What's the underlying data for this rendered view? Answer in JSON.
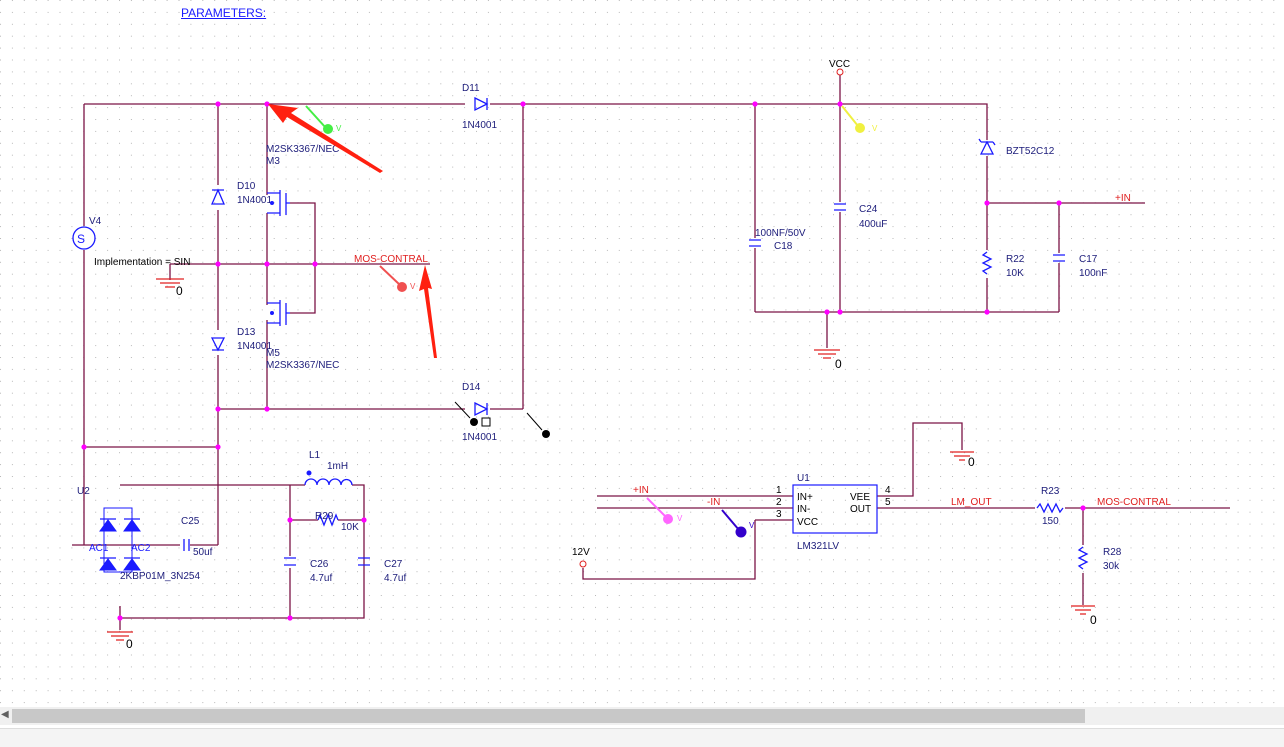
{
  "parameters_label": "PARAMETERS:",
  "colors": {
    "wire": "#7b1446",
    "junction": "#ff00ff",
    "symbol": "#1a1aff",
    "net_label": "#e02020",
    "annotation_arrow": "#ff2010"
  },
  "components": {
    "v4": {
      "ref": "V4",
      "value": "Implementation = SIN",
      "glyph": "S"
    },
    "d10": {
      "ref": "D10",
      "value": "1N4001"
    },
    "d13": {
      "ref": "D13",
      "value": "1N4001"
    },
    "d11": {
      "ref": "D11",
      "value": "1N4001"
    },
    "d14": {
      "ref": "D14",
      "value": "1N4001"
    },
    "m3": {
      "ref": "M3",
      "value": "M2SK3367/NEC"
    },
    "m5": {
      "ref": "M5",
      "value": "M2SK3367/NEC"
    },
    "u2": {
      "ref": "U2",
      "value": "2KBP01M_3N254",
      "pin_ac1": "AC1",
      "pin_ac2": "AC2"
    },
    "c25": {
      "ref": "C25",
      "value": "50uf"
    },
    "l1": {
      "ref": "L1",
      "value": "1mH"
    },
    "r29": {
      "ref": "R29",
      "value": "10K"
    },
    "c26": {
      "ref": "C26",
      "value": "4.7uf"
    },
    "c27": {
      "ref": "C27",
      "value": "4.7uf"
    },
    "c18": {
      "ref": "C18",
      "value": "100NF/50V"
    },
    "c24": {
      "ref": "C24",
      "value": "400uF"
    },
    "zener": {
      "value": "BZT52C12"
    },
    "r22": {
      "ref": "R22",
      "value": "10K"
    },
    "c17": {
      "ref": "C17",
      "value": "100nF"
    },
    "u1": {
      "ref": "U1",
      "value": "LM321LV",
      "pins": [
        "IN+",
        "IN-",
        "VCC",
        "VEE",
        "OUT"
      ],
      "pin_numbers": [
        "1",
        "2",
        "3",
        "4",
        "5"
      ]
    },
    "r23": {
      "ref": "R23",
      "value": "150"
    },
    "r28": {
      "ref": "R28",
      "value": "30k"
    }
  },
  "nets": {
    "mos_contral": "MOS-CONTRAL",
    "plus_in": "+IN",
    "minus_in": "-IN",
    "lm_out": "LM_OUT",
    "vcc": "VCC",
    "v12": "12V",
    "ground": "0"
  },
  "probes": [
    {
      "label": "V",
      "color": "#44ee44"
    },
    {
      "label": "V",
      "color": "#f0f040"
    },
    {
      "label": "V",
      "color": "#f05050"
    },
    {
      "label": "V",
      "color": "#ff66ff"
    },
    {
      "label": "V",
      "color": "#3300cc"
    }
  ]
}
